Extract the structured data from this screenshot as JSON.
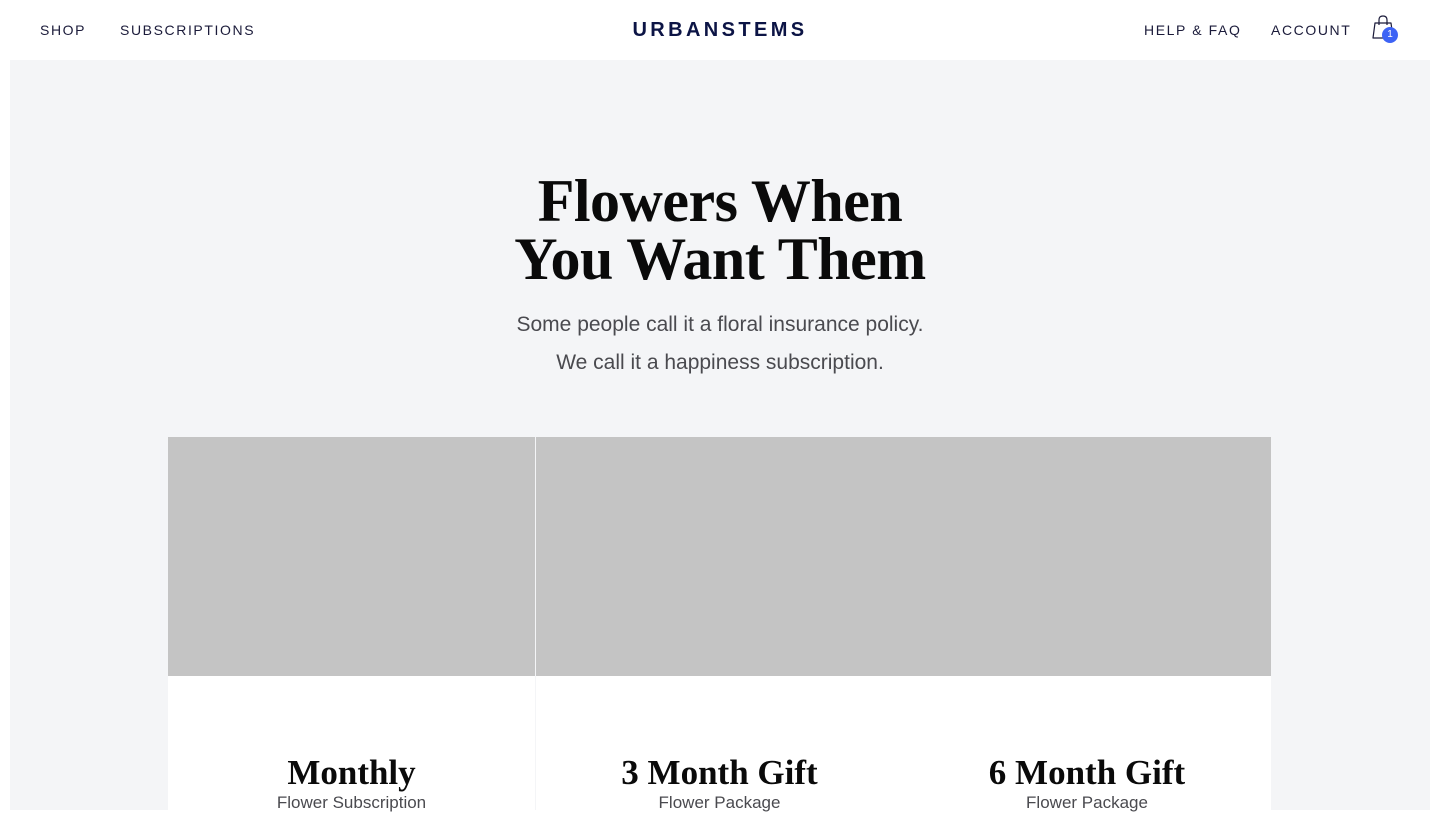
{
  "nav": {
    "shop": "SHOP",
    "subscriptions": "SUBSCRIPTIONS",
    "logo": "URBANSTEMS",
    "help": "HELP & FAQ",
    "account": "ACCOUNT",
    "cart_count": "1"
  },
  "hero": {
    "title_line1": "Flowers When",
    "title_line2": "You Want Them",
    "subtitle_line1": "Some people call it a floral insurance policy.",
    "subtitle_line2": "We call it a happiness subscription."
  },
  "cards": [
    {
      "title": "Monthly",
      "subtitle": "Flower Subscription"
    },
    {
      "title": "3 Month Gift",
      "subtitle": "Flower Package"
    },
    {
      "title": "6 Month Gift",
      "subtitle": "Flower Package"
    }
  ],
  "colors": {
    "logo": "#0c1445",
    "badge": "#3d63f5",
    "hero_bg": "#f4f5f7",
    "placeholder": "#c4c4c4"
  },
  "icons": {
    "cart": "shopping-bag-icon"
  }
}
